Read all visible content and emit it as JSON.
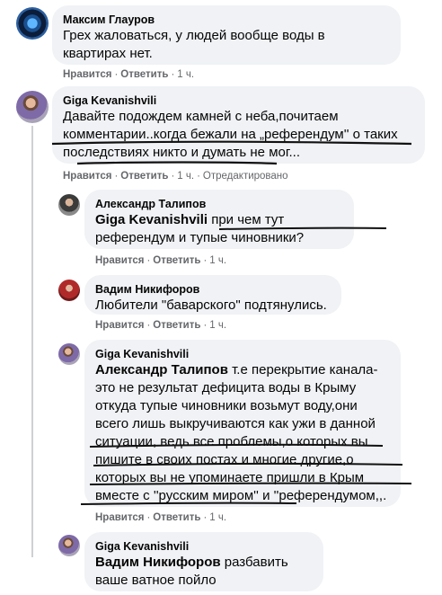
{
  "comments": [
    {
      "author": "Максим Глауров",
      "text": "Грех жаловаться, у людей вообще воды в квартирах нет.",
      "like": "Нравится",
      "reply": "Ответить",
      "time": "1 ч."
    },
    {
      "author": "Giga Kevanishvili",
      "text": "Давайте подождем камней с неба,почитаем комментарии..когда бежали на „референдум'' о таких последствиях никто и думать не мог...",
      "like": "Нравится",
      "reply": "Ответить",
      "time": "1 ч.",
      "edited": "Отредактировано"
    },
    {
      "author": "Александр Талипов",
      "mention": "Giga Kevanishvili",
      "text": "при чем тут референдум и тупые чиновники?",
      "like": "Нравится",
      "reply": "Ответить",
      "time": "1 ч."
    },
    {
      "author": "Вадим Никифоров",
      "text": "Любители \"баварского\" подтянулись.",
      "like": "Нравится",
      "reply": "Ответить",
      "time": "1 ч."
    },
    {
      "author": "Giga Kevanishvili",
      "mention": "Александр Талипов",
      "text": "т.е перекрытие канала-это не результат дефицита воды в Крыму откуда тупые чиновники возьмут воду,они всего лишь выкручиваются как ужи в данной ситуации, ведь все проблемы,о которых вы пишите в своих постах и многие другие,о которых вы не упоминаете пришли в Крым вместе с ''русским миром'' и ''референдумом,,.",
      "like": "Нравится",
      "reply": "Ответить",
      "time": "1 ч."
    },
    {
      "author": "Giga Kevanishvili",
      "mention": "Вадим Никифоров",
      "text": "разбавить ваше ватное пойло"
    }
  ]
}
